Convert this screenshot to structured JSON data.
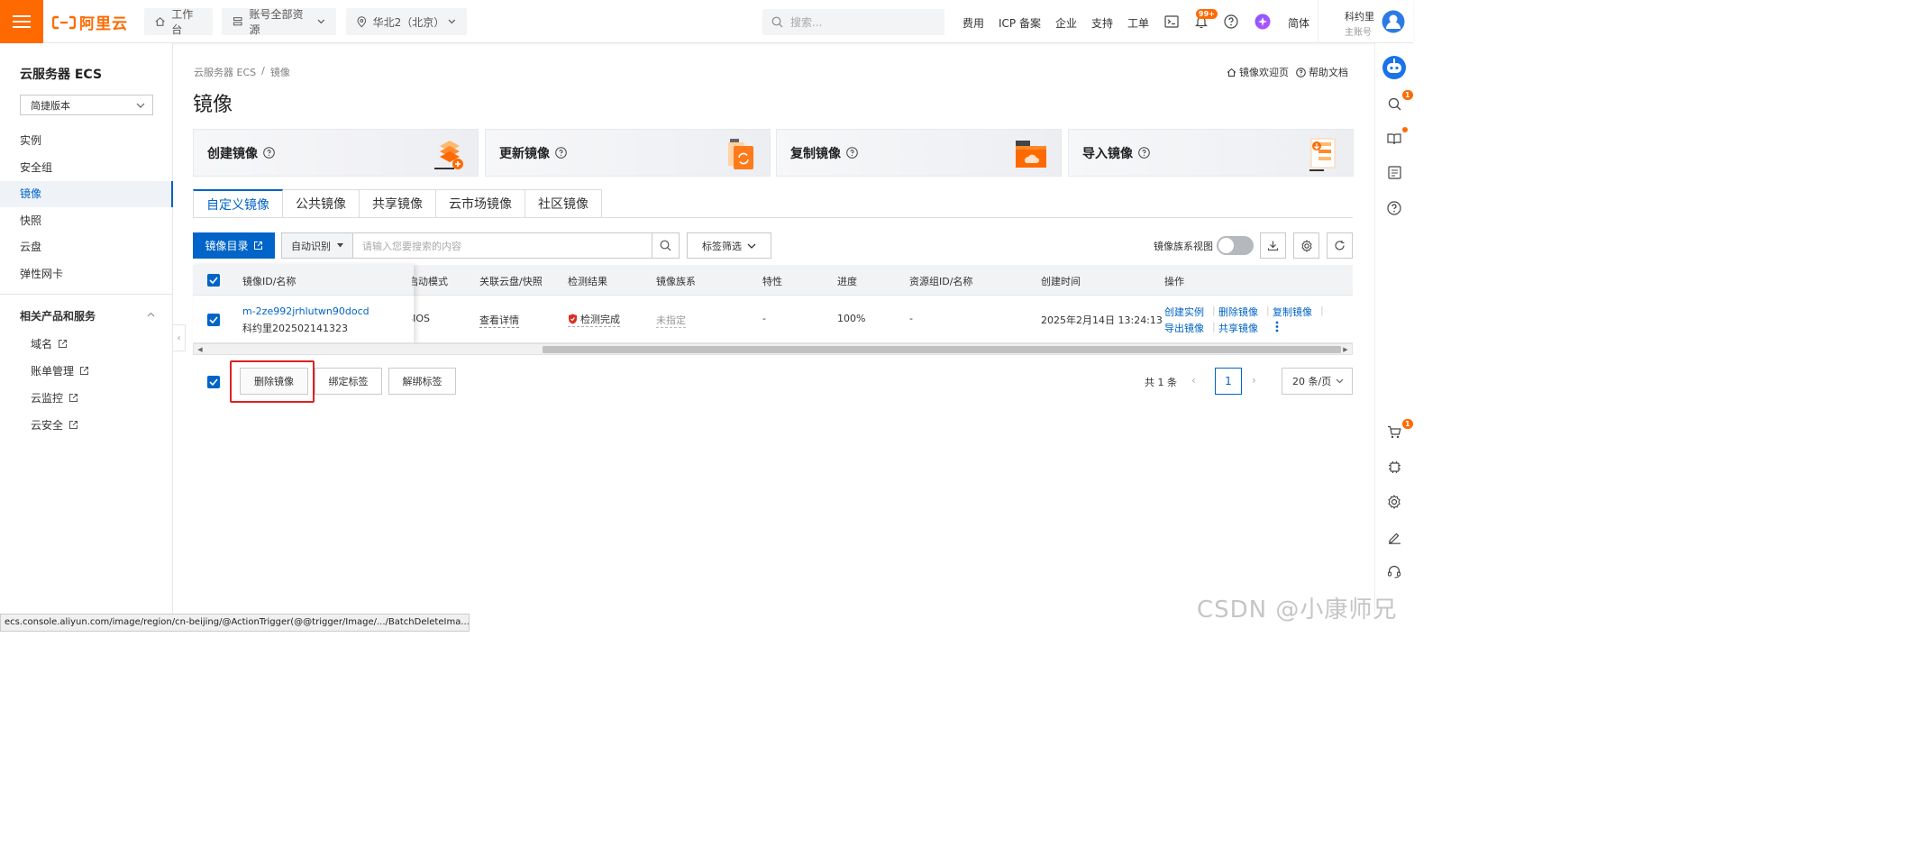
{
  "topbar": {
    "logo_text": "阿里云",
    "workbench": "工作台",
    "resources": "账号全部资源",
    "region": "华北2（北京）",
    "search_placeholder": "搜索...",
    "links": [
      "费用",
      "ICP 备案",
      "企业",
      "支持",
      "工单"
    ],
    "notify_badge": "99+",
    "language": "简体",
    "account_name": "科约里",
    "account_type": "主账号"
  },
  "sidebar": {
    "title": "云服务器 ECS",
    "version_select": "简捷版本",
    "items": [
      "实例",
      "安全组",
      "镜像",
      "快照",
      "云盘",
      "弹性网卡"
    ],
    "active_item": "镜像",
    "section_title": "相关产品和服务",
    "sub_items": [
      "域名",
      "账单管理",
      "云监控",
      "云安全"
    ]
  },
  "header": {
    "breadcrumb": [
      "云服务器 ECS",
      "/",
      "镜像"
    ],
    "title": "镜像",
    "welcome_link": "镜像欢迎页",
    "help_link": "帮助文档"
  },
  "cards": [
    "创建镜像",
    "更新镜像",
    "复制镜像",
    "导入镜像"
  ],
  "tabs": [
    "自定义镜像",
    "公共镜像",
    "共享镜像",
    "云市场镜像",
    "社区镜像"
  ],
  "toolbar": {
    "catalog_button": "镜像目录",
    "auto_detect": "自动识别",
    "search_placeholder": "请输入您要搜索的内容",
    "tag_filter": "标签筛选",
    "family_view_label": "镜像族系视图"
  },
  "table": {
    "columns": [
      "镜像ID/名称",
      "启动模式",
      "关联云盘/快照",
      "检测结果",
      "镜像族系",
      "特性",
      "进度",
      "资源组ID/名称",
      "创建时间",
      "操作"
    ],
    "rows": [
      {
        "id": "m-2ze992jrhlutwn90docd",
        "name": "科约里202502141323",
        "boot_mode": "BIOS",
        "linked": "查看详情",
        "check_result": "检测完成",
        "family": "未指定",
        "feature": "-",
        "progress": "100%",
        "resource_group": "-",
        "created": "2025年2月14日 13:24:13",
        "actions": [
          "创建实例",
          "删除镜像",
          "复制镜像",
          "导出镜像",
          "共享镜像"
        ]
      }
    ]
  },
  "footer": {
    "batch_buttons": [
      "删除镜像",
      "绑定标签",
      "解绑标签"
    ],
    "total": "共 1 条",
    "current_page": "1",
    "page_size": "20 条/页"
  },
  "right_rail": {
    "search_badge": "1",
    "cart_badge": "1"
  },
  "status_bar": "ecs.console.aliyun.com/image/region/cn-beijing/@ActionTrigger(@@trigger/Image/.../BatchDeleteIma...",
  "watermark": "CSDN @小康师兄",
  "colors": {
    "brand": "#ff6a00",
    "primary": "#0064c8",
    "highlight": "#e02020",
    "check_ok": "#d93026"
  }
}
